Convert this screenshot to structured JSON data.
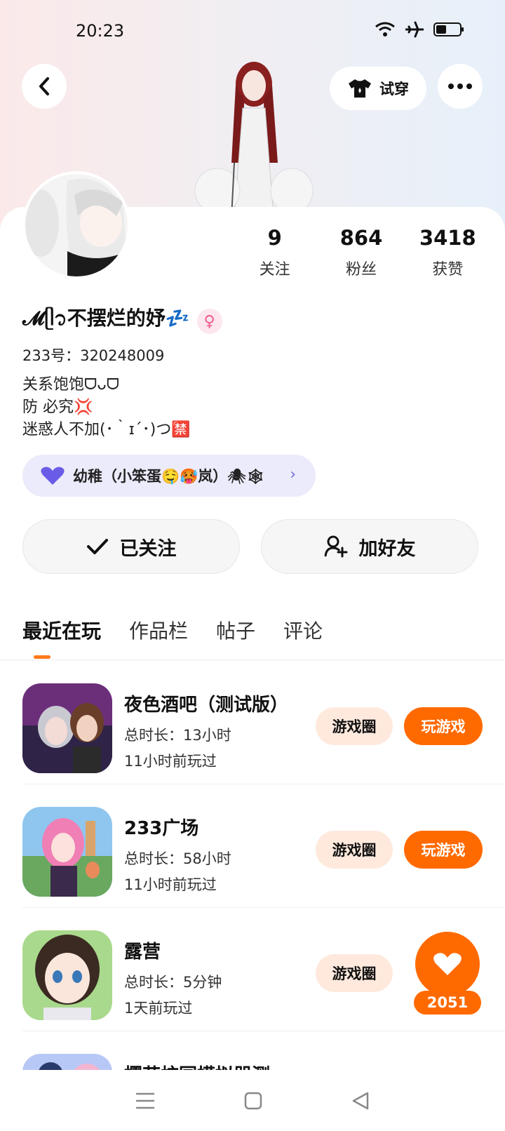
{
  "status": {
    "time": "20:23"
  },
  "header": {
    "tryon_label": "试穿"
  },
  "stats": [
    {
      "value": "9",
      "label": "关注"
    },
    {
      "value": "864",
      "label": "粉丝"
    },
    {
      "value": "3418",
      "label": "获赞"
    }
  ],
  "profile": {
    "username": "𝓜ᥫ᭡不摆烂的妤💤",
    "id_line": "233号：320248009",
    "bio": [
      "关系饱饱ᗜᴗᗜ",
      "防 必究💢",
      "迷惑人不加(･｀ɪ´･)つ🈲"
    ],
    "group_chip": "幼稚（小笨蛋🤤🥵岚）🕷🕸"
  },
  "actions": {
    "followed": "已关注",
    "add_friend": "加好友"
  },
  "tabs": [
    "最近在玩",
    "作品栏",
    "帖子",
    "评论"
  ],
  "games": [
    {
      "title": "夜色酒吧（测试版）",
      "duration": "总时长：13小时",
      "last_played": "11小时前玩过",
      "circle": "游戏圈",
      "play": "玩游戏"
    },
    {
      "title": "233广场",
      "duration": "总时长：58小时",
      "last_played": "11小时前玩过",
      "circle": "游戏圈",
      "play": "玩游戏"
    },
    {
      "title": "露营",
      "duration": "总时长：5分钟",
      "last_played": "1天前玩过",
      "circle": "游戏圈"
    },
    {
      "title": "樱花校园模拟器测"
    }
  ],
  "likes": {
    "count": "2051"
  },
  "colors": {
    "accent": "#ff6a00",
    "chip_bg": "#ecebfb",
    "circle_bg": "#ffe9dd"
  }
}
